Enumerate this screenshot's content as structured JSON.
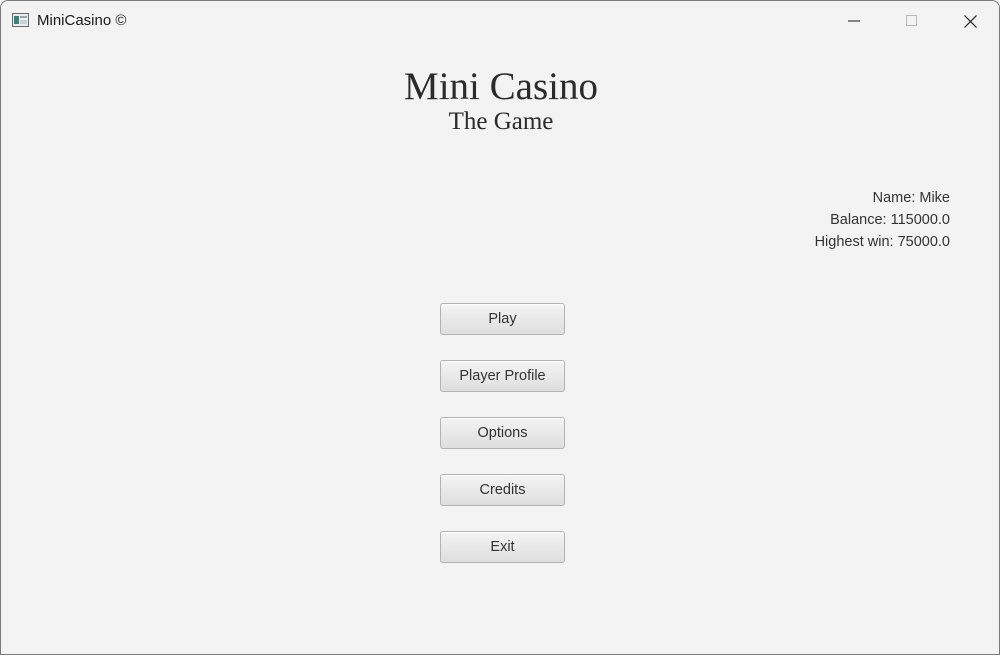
{
  "window": {
    "title": "MiniCasino ©",
    "controls": {
      "minimize_icon": "minimize-icon",
      "maximize_icon": "maximize-icon",
      "close_icon": "close-icon"
    }
  },
  "header": {
    "title": "Mini Casino",
    "subtitle": "The Game"
  },
  "player": {
    "name": "Name: Mike",
    "balance": "Balance: 115000.0",
    "highest_win": "Highest win: 75000.0"
  },
  "menu": {
    "play": "Play",
    "player_profile": "Player Profile",
    "options": "Options",
    "credits": "Credits",
    "exit": "Exit"
  }
}
